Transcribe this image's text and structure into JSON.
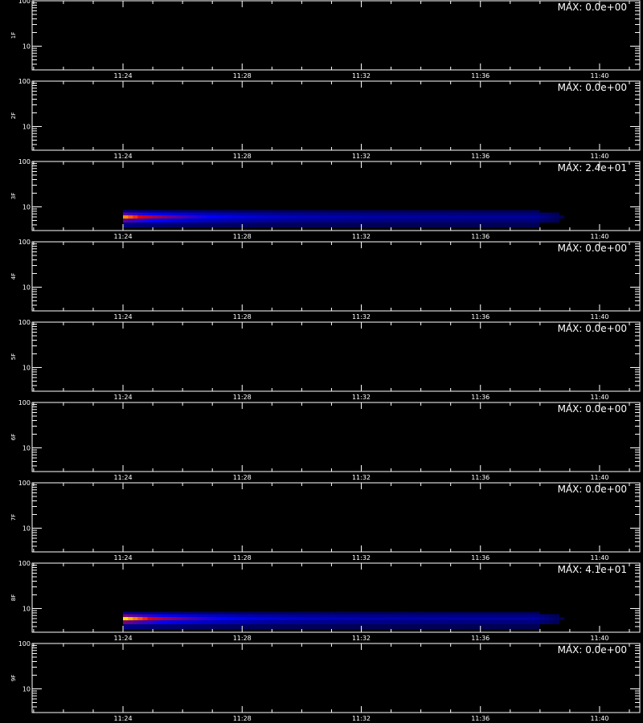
{
  "chart_data": [
    {
      "type": "heatmap",
      "ylabel": "1F",
      "max_label": "MAX: 0.0e+00",
      "max": 0,
      "ylim": [
        3,
        100
      ],
      "yscale": "log",
      "y_ticks": [
        "100",
        "10"
      ],
      "x_ticks": [
        "11:24",
        "11:28",
        "11:32",
        "11:36",
        "11:40"
      ],
      "x_minutes": [
        0,
        4,
        8,
        12,
        16
      ],
      "xlim_minutes": [
        -3.05,
        17.35
      ],
      "signal": null
    },
    {
      "type": "heatmap",
      "ylabel": "2F",
      "max_label": "MAX: 0.0e+00",
      "max": 0,
      "ylim": [
        3,
        100
      ],
      "yscale": "log",
      "y_ticks": [
        "100",
        "10"
      ],
      "x_ticks": [
        "11:24",
        "11:28",
        "11:32",
        "11:36",
        "11:40"
      ],
      "x_minutes": [
        0,
        4,
        8,
        12,
        16
      ],
      "xlim_minutes": [
        -3.05,
        17.35
      ],
      "signal": null
    },
    {
      "type": "heatmap",
      "ylabel": "3F",
      "max_label": "MAX: 2.4e+01",
      "max": 24,
      "ylim": [
        3,
        100
      ],
      "yscale": "log",
      "y_ticks": [
        "100",
        "10"
      ],
      "x_ticks": [
        "11:24",
        "11:28",
        "11:32",
        "11:36",
        "11:40"
      ],
      "x_minutes": [
        0,
        4,
        8,
        12,
        16
      ],
      "xlim_minutes": [
        -3.05,
        17.35
      ],
      "signal": {
        "start_minute": 0,
        "end_minute": 14.8,
        "channel_min": 4,
        "channel_max": 9,
        "peak_channel": 6
      }
    },
    {
      "type": "heatmap",
      "ylabel": "4F",
      "max_label": "MAX: 0.0e+00",
      "max": 0,
      "ylim": [
        3,
        100
      ],
      "yscale": "log",
      "y_ticks": [
        "100",
        "10"
      ],
      "x_ticks": [
        "11:24",
        "11:28",
        "11:32",
        "11:36",
        "11:40"
      ],
      "x_minutes": [
        0,
        4,
        8,
        12,
        16
      ],
      "xlim_minutes": [
        -3.05,
        17.35
      ],
      "signal": null
    },
    {
      "type": "heatmap",
      "ylabel": "5F",
      "max_label": "MAX: 0.0e+00",
      "max": 0,
      "ylim": [
        3,
        100
      ],
      "yscale": "log",
      "y_ticks": [
        "100",
        "10"
      ],
      "x_ticks": [
        "11:24",
        "11:28",
        "11:32",
        "11:36",
        "11:40"
      ],
      "x_minutes": [
        0,
        4,
        8,
        12,
        16
      ],
      "xlim_minutes": [
        -3.05,
        17.35
      ],
      "signal": null
    },
    {
      "type": "heatmap",
      "ylabel": "6F",
      "max_label": "MAX: 0.0e+00",
      "max": 0,
      "ylim": [
        3,
        100
      ],
      "yscale": "log",
      "y_ticks": [
        "100",
        "10"
      ],
      "x_ticks": [
        "11:24",
        "11:28",
        "11:32",
        "11:36",
        "11:40"
      ],
      "x_minutes": [
        0,
        4,
        8,
        12,
        16
      ],
      "xlim_minutes": [
        -3.05,
        17.35
      ],
      "signal": null
    },
    {
      "type": "heatmap",
      "ylabel": "7F",
      "max_label": "MAX: 0.0e+00",
      "max": 0,
      "ylim": [
        3,
        100
      ],
      "yscale": "log",
      "y_ticks": [
        "100",
        "10"
      ],
      "x_ticks": [
        "11:24",
        "11:28",
        "11:32",
        "11:36",
        "11:40"
      ],
      "x_minutes": [
        0,
        4,
        8,
        12,
        16
      ],
      "xlim_minutes": [
        -3.05,
        17.35
      ],
      "signal": null
    },
    {
      "type": "heatmap",
      "ylabel": "8F",
      "max_label": "MAX: 4.1e+01",
      "max": 41,
      "ylim": [
        3,
        100
      ],
      "yscale": "log",
      "y_ticks": [
        "100",
        "10"
      ],
      "x_ticks": [
        "11:24",
        "11:28",
        "11:32",
        "11:36",
        "11:40"
      ],
      "x_minutes": [
        0,
        4,
        8,
        12,
        16
      ],
      "xlim_minutes": [
        -3.05,
        17.35
      ],
      "signal": {
        "start_minute": 0,
        "end_minute": 14.8,
        "channel_min": 4,
        "channel_max": 9,
        "peak_channel": 6
      }
    },
    {
      "type": "heatmap",
      "ylabel": "9F",
      "max_label": "MAX: 0.0e+00",
      "max": 0,
      "ylim": [
        3,
        100
      ],
      "yscale": "log",
      "y_ticks": [
        "100",
        "10"
      ],
      "x_ticks": [
        "11:24",
        "11:28",
        "11:32",
        "11:36",
        "11:40"
      ],
      "x_minutes": [
        0,
        4,
        8,
        12,
        16
      ],
      "xlim_minutes": [
        -3.05,
        17.35
      ],
      "signal": null
    }
  ],
  "colors": {
    "background": "#000000",
    "axes": "#ffffff",
    "text": "#ffffff"
  }
}
